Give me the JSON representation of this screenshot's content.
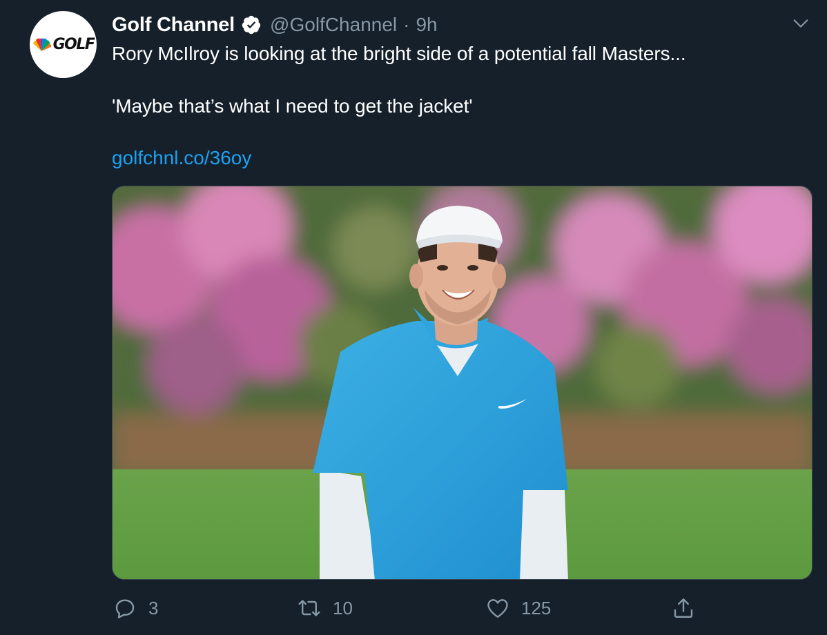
{
  "tweet": {
    "author_name": "Golf Channel",
    "handle": "@GolfChannel",
    "separator": "·",
    "time": "9h",
    "avatar_text": "GOLF",
    "text_line1": "Rory McIlroy is looking at the bright side of a potential fall Masters...",
    "text_line2": "'Maybe that’s what I need to get the jacket'",
    "link": "golfchnl.co/36oy"
  },
  "actions": {
    "replies": "3",
    "retweets": "10",
    "likes": "125"
  },
  "colors": {
    "background": "#15202b",
    "secondary_text": "#8899a6",
    "link": "#1da1f2",
    "verified_badge": "#ffffff"
  },
  "icons": {
    "verified": "verified-badge-icon",
    "caret": "chevron-down-icon",
    "reply": "reply-icon",
    "retweet": "retweet-icon",
    "like": "heart-icon",
    "share": "share-icon"
  }
}
